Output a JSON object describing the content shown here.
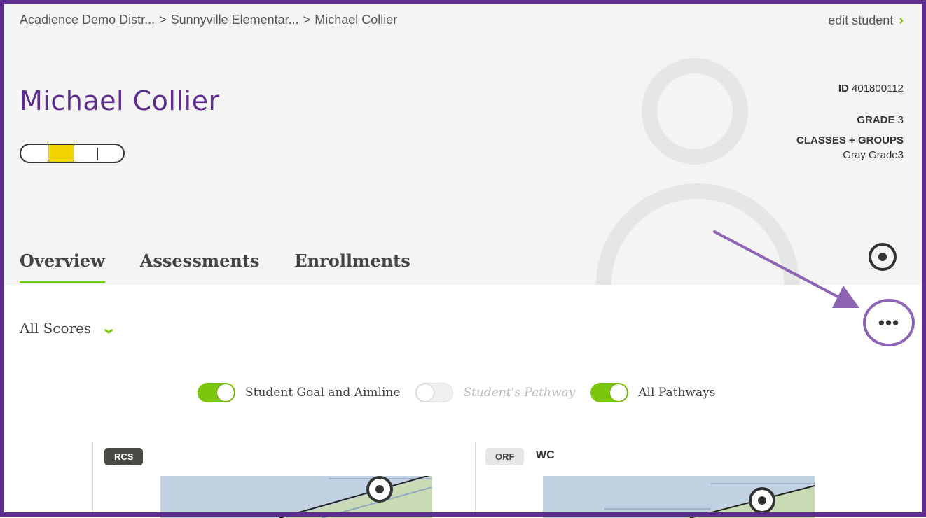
{
  "breadcrumb": {
    "items": [
      "Acadience Demo Distr...",
      "Sunnyville Elementar...",
      "Michael Collier"
    ],
    "separator": ">"
  },
  "edit_student": {
    "label": "edit student"
  },
  "student": {
    "name": "Michael Collier",
    "id_label": "ID",
    "id_value": "401800112",
    "grade_label": "GRADE",
    "grade_value": "3",
    "classes_label": "CLASSES + GROUPS",
    "classes_value": "Gray Grade3"
  },
  "tabs": [
    {
      "label": "Overview",
      "active": true
    },
    {
      "label": "Assessments",
      "active": false
    },
    {
      "label": "Enrollments",
      "active": false
    }
  ],
  "filter": {
    "label": "All Scores"
  },
  "more_button": {
    "label": "•••"
  },
  "toggles": [
    {
      "label": "Student Goal and Aimline",
      "on": true
    },
    {
      "label": "Student's Pathway",
      "on": false
    },
    {
      "label": "All Pathways",
      "on": true
    }
  ],
  "cards": [
    {
      "badge": "RCS",
      "subtitle": ""
    },
    {
      "badge": "ORF",
      "subtitle": "WC"
    }
  ],
  "colors": {
    "brand_purple": "#5c2d8c",
    "accent_green": "#7ac70c",
    "annotation_purple": "#8d63b3",
    "level_yellow": "#f2d400"
  },
  "icons": [
    "chevron-right-icon",
    "chevron-down-icon",
    "target-icon",
    "more-icon",
    "annotation-arrow"
  ]
}
